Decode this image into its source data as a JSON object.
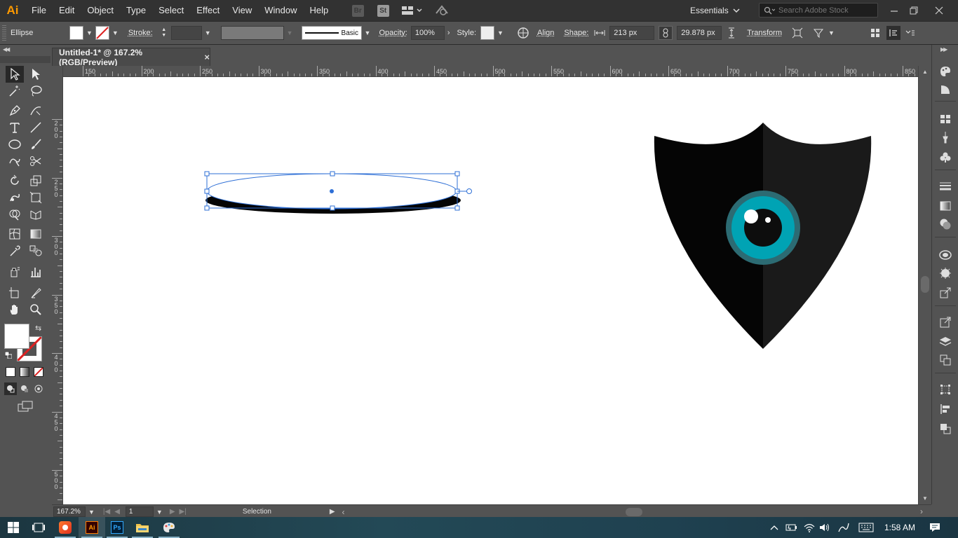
{
  "app": {
    "logo": "Ai"
  },
  "menu": [
    "File",
    "Edit",
    "Object",
    "Type",
    "Select",
    "Effect",
    "View",
    "Window",
    "Help"
  ],
  "menubar_icons": {
    "bridge": "Br",
    "stock": "St"
  },
  "workspace": {
    "label": "Essentials"
  },
  "search": {
    "placeholder": "Search Adobe Stock"
  },
  "controlbar": {
    "object_label": "Ellipse",
    "stroke_label": "Stroke:",
    "stroke_profile": "Basic",
    "opacity_label": "Opacity:",
    "opacity_value": "100%",
    "style_label": "Style:",
    "align_label": "Align",
    "shape_label": "Shape:",
    "width_value": "213 px",
    "height_value": "29.878 px",
    "transform_label": "Transform"
  },
  "document": {
    "tab_title": "Untitled-1* @ 167.2% (RGB/Preview)",
    "close": "×"
  },
  "rulers": {
    "h_labels": [
      "150",
      "200",
      "250",
      "300",
      "350",
      "400",
      "450",
      "500",
      "550",
      "600",
      "650",
      "700",
      "750",
      "800",
      "850"
    ],
    "v_labels": [
      "200",
      "250",
      "300",
      "350",
      "400",
      "450",
      "500"
    ]
  },
  "statusbar": {
    "zoom": "167.2%",
    "page": "1",
    "tool": "Selection"
  },
  "taskbar": {
    "time": "1:58 AM"
  },
  "colors": {
    "iris": "#00a3b4",
    "iris_ring": "#2c6b73",
    "pupil": "#0d0d0d",
    "shield_left": "#050505",
    "shield_right": "#1a1a1a",
    "selection": "#2e6fd6",
    "app_accent": "#ff9a00"
  }
}
